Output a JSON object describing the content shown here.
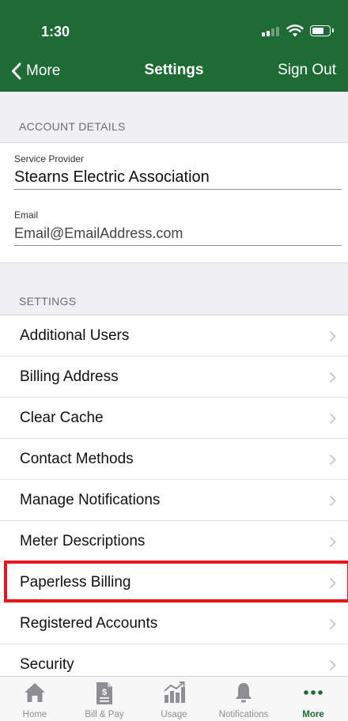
{
  "status_bar": {
    "time": "1:30",
    "icons": [
      "signal-icon",
      "wifi-icon",
      "battery-icon"
    ]
  },
  "nav": {
    "back_label": "More",
    "title": "Settings",
    "right_action": "Sign Out"
  },
  "colors": {
    "header": "#1e6b35",
    "highlight": "#e8151b",
    "background": "#efeff4"
  },
  "account_details": {
    "header": "ACCOUNT DETAILS",
    "service_provider": {
      "label": "Service Provider",
      "value": "Stearns Electric Association"
    },
    "email": {
      "label": "Email",
      "value": "Email@EmailAddress.com"
    }
  },
  "settings": {
    "header": "SETTINGS",
    "items": [
      {
        "label": "Additional Users"
      },
      {
        "label": "Billing Address"
      },
      {
        "label": "Clear Cache"
      },
      {
        "label": "Contact Methods"
      },
      {
        "label": "Manage Notifications"
      },
      {
        "label": "Meter Descriptions"
      },
      {
        "label": "Paperless Billing",
        "highlighted": true
      },
      {
        "label": "Registered Accounts"
      },
      {
        "label": "Security"
      }
    ]
  },
  "tabbar": {
    "active": "More",
    "tabs": [
      {
        "label": "Home",
        "icon": "home-icon"
      },
      {
        "label": "Bill & Pay",
        "icon": "bill-icon"
      },
      {
        "label": "Usage",
        "icon": "usage-icon"
      },
      {
        "label": "Notifications",
        "icon": "bell-icon"
      },
      {
        "label": "More",
        "icon": "more-icon"
      }
    ]
  }
}
